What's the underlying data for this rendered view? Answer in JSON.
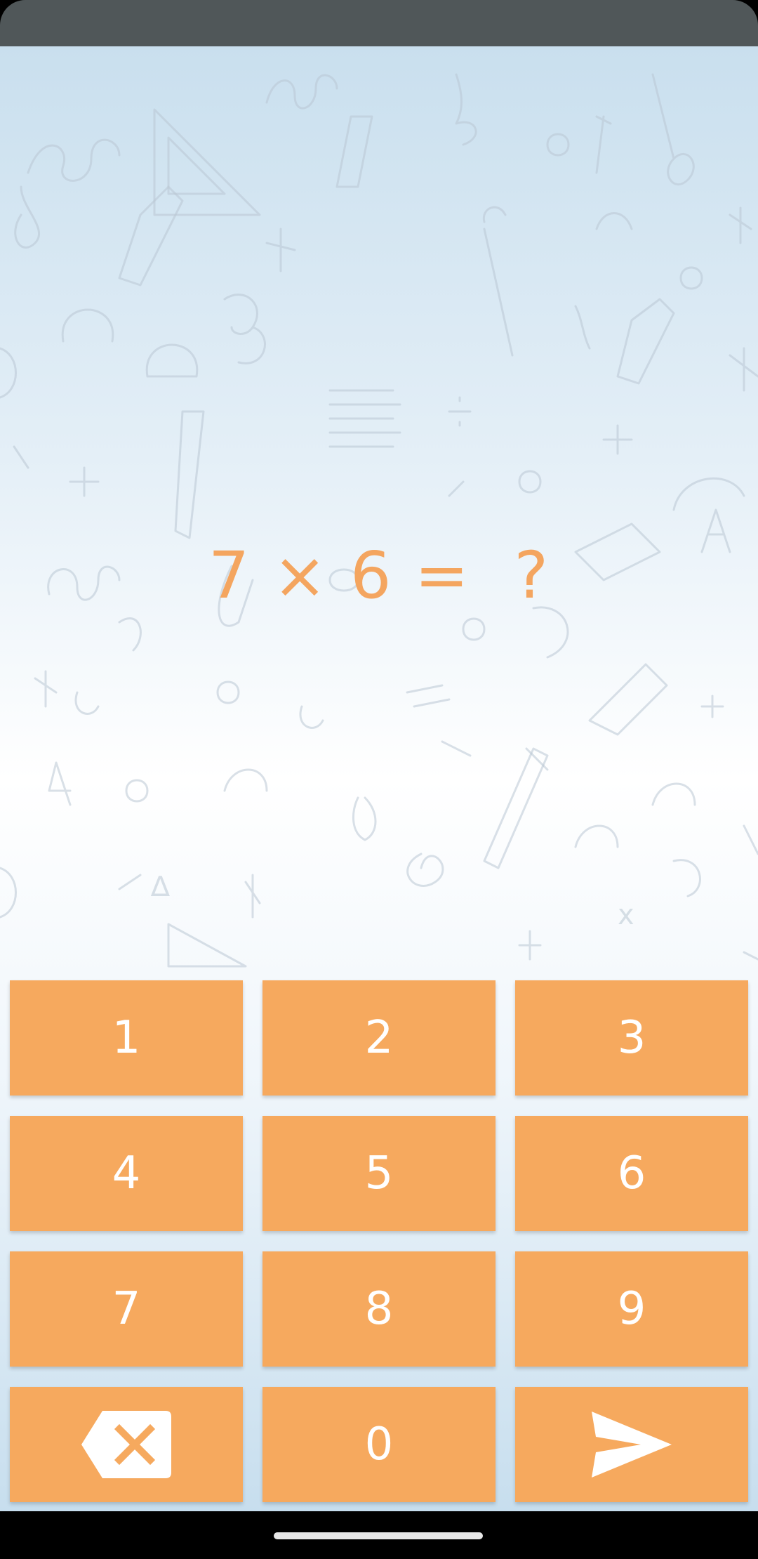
{
  "question": {
    "left": "7",
    "operator": "×",
    "right": "6",
    "equals": "=",
    "answer": "?"
  },
  "keypad": {
    "keys": [
      {
        "label": "1"
      },
      {
        "label": "2"
      },
      {
        "label": "3"
      },
      {
        "label": "4"
      },
      {
        "label": "5"
      },
      {
        "label": "6"
      },
      {
        "label": "7"
      },
      {
        "label": "8"
      },
      {
        "label": "9"
      },
      {
        "icon": "backspace-icon"
      },
      {
        "label": "0"
      },
      {
        "icon": "send-icon"
      }
    ]
  },
  "colors": {
    "accent": "#f6a95e",
    "question_text": "#f4a55f",
    "key_text": "#ffffff",
    "status_bar": "#505759"
  }
}
